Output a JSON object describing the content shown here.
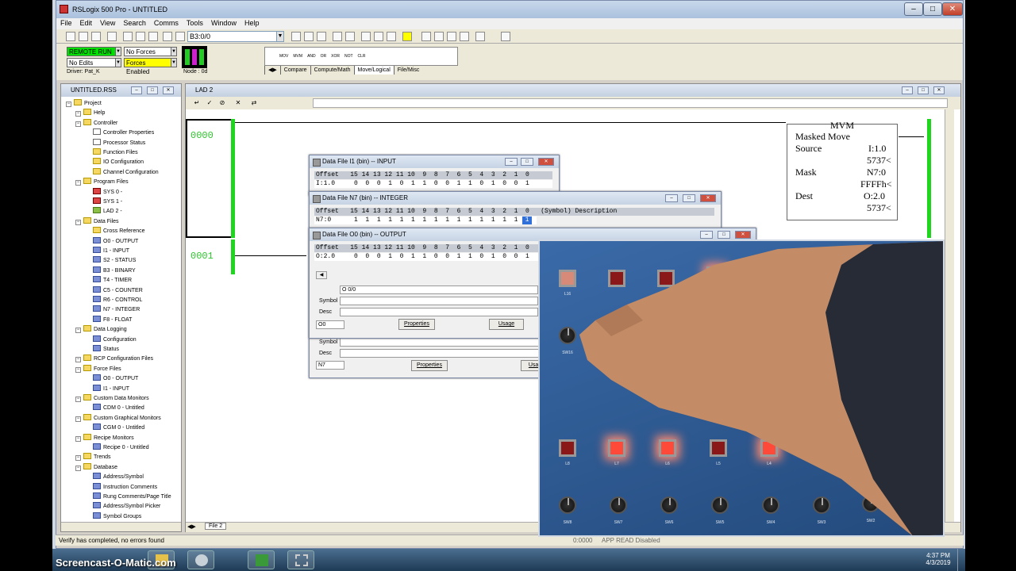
{
  "window": {
    "title": "RSLogix 500 Pro - UNTITLED"
  },
  "menu": [
    "File",
    "Edit",
    "View",
    "Search",
    "Comms",
    "Tools",
    "Window",
    "Help"
  ],
  "toolbar": {
    "address_value": "B3:0/0"
  },
  "processor": {
    "mode": "REMOTE RUN",
    "forces": "No Forces",
    "edits": "No Edits",
    "forces_enabled": "Forces Enabled",
    "node": "Node :  0d",
    "driver": "Driver: Pat_K"
  },
  "instruction_palette": {
    "items": [
      "MOV",
      "MVM",
      "AND",
      "OR",
      "XOR",
      "NOT",
      "CLR"
    ],
    "tabs": [
      "Compare",
      "Compute/Math",
      "Move/Logical",
      "File/Misc"
    ],
    "active_tab": "Move/Logical"
  },
  "project_window": {
    "title": "UNTITLED.RSS",
    "tree": [
      {
        "label": "Project",
        "level": 0,
        "icon": "folder-icon"
      },
      {
        "label": "Help",
        "level": 1,
        "icon": "folder-icon"
      },
      {
        "label": "Controller",
        "level": 1,
        "icon": "folder-icon"
      },
      {
        "label": "Controller Properties",
        "level": 2,
        "icon": "properties-icon"
      },
      {
        "label": "Processor Status",
        "level": 2,
        "icon": "status-icon"
      },
      {
        "label": "Function Files",
        "level": 2,
        "icon": "function-files-icon"
      },
      {
        "label": "IO Configuration",
        "level": 2,
        "icon": "io-config-icon"
      },
      {
        "label": "Channel Configuration",
        "level": 2,
        "icon": "channel-config-icon"
      },
      {
        "label": "Program Files",
        "level": 1,
        "icon": "folder-icon"
      },
      {
        "label": "SYS 0 -",
        "level": 2,
        "icon": "sys-file-icon"
      },
      {
        "label": "SYS 1 -",
        "level": 2,
        "icon": "sys-file-icon"
      },
      {
        "label": "LAD 2 -",
        "level": 2,
        "icon": "ladder-file-icon"
      },
      {
        "label": "Data Files",
        "level": 1,
        "icon": "folder-icon"
      },
      {
        "label": "Cross Reference",
        "level": 2,
        "icon": "cross-reference-icon"
      },
      {
        "label": "O0 - OUTPUT",
        "level": 2,
        "icon": "data-file-icon"
      },
      {
        "label": "I1 - INPUT",
        "level": 2,
        "icon": "data-file-icon"
      },
      {
        "label": "S2 - STATUS",
        "level": 2,
        "icon": "data-file-icon"
      },
      {
        "label": "B3 - BINARY",
        "level": 2,
        "icon": "data-file-icon"
      },
      {
        "label": "T4 - TIMER",
        "level": 2,
        "icon": "data-file-icon"
      },
      {
        "label": "C5 - COUNTER",
        "level": 2,
        "icon": "data-file-icon"
      },
      {
        "label": "R6 - CONTROL",
        "level": 2,
        "icon": "data-file-icon"
      },
      {
        "label": "N7 - INTEGER",
        "level": 2,
        "icon": "data-file-icon"
      },
      {
        "label": "F8 - FLOAT",
        "level": 2,
        "icon": "data-file-icon"
      },
      {
        "label": "Data Logging",
        "level": 1,
        "icon": "folder-icon"
      },
      {
        "label": "Configuration",
        "level": 2,
        "icon": "data-file-icon"
      },
      {
        "label": "Status",
        "level": 2,
        "icon": "data-file-icon"
      },
      {
        "label": "RCP Configuration Files",
        "level": 1,
        "icon": "folder-icon"
      },
      {
        "label": "Force Files",
        "level": 1,
        "icon": "folder-icon"
      },
      {
        "label": "O0 - OUTPUT",
        "level": 2,
        "icon": "data-file-icon"
      },
      {
        "label": "I1 - INPUT",
        "level": 2,
        "icon": "data-file-icon"
      },
      {
        "label": "Custom Data Monitors",
        "level": 1,
        "icon": "folder-icon"
      },
      {
        "label": "CDM 0 - Untitled",
        "level": 2,
        "icon": "data-file-icon"
      },
      {
        "label": "Custom Graphical Monitors",
        "level": 1,
        "icon": "folder-icon"
      },
      {
        "label": "CGM 0 - Untitled",
        "level": 2,
        "icon": "data-file-icon"
      },
      {
        "label": "Recipe Monitors",
        "level": 1,
        "icon": "folder-icon"
      },
      {
        "label": "Recipe 0 - Untitled",
        "level": 2,
        "icon": "data-file-icon"
      },
      {
        "label": "Trends",
        "level": 1,
        "icon": "folder-icon"
      },
      {
        "label": "Database",
        "level": 1,
        "icon": "folder-icon"
      },
      {
        "label": "Address/Symbol",
        "level": 2,
        "icon": "data-file-icon"
      },
      {
        "label": "Instruction Comments",
        "level": 2,
        "icon": "data-file-icon"
      },
      {
        "label": "Rung Comments/Page Title",
        "level": 2,
        "icon": "data-file-icon"
      },
      {
        "label": "Address/Symbol Picker",
        "level": 2,
        "icon": "data-file-icon"
      },
      {
        "label": "Symbol Groups",
        "level": 2,
        "icon": "data-file-icon"
      }
    ]
  },
  "ladder_window": {
    "title": "LAD 2",
    "rungs": [
      "0000",
      "0001"
    ],
    "file_tab": "File 2",
    "mvm": {
      "mnemonic": "MVM",
      "name": "Masked Move",
      "source_label": "Source",
      "source_addr": "I:1.0",
      "source_val": "5737<",
      "mask_label": "Mask",
      "mask_addr": "N7:0",
      "mask_val": "FFFFh<",
      "dest_label": "Dest",
      "dest_addr": "O:2.0",
      "dest_val": "5737<"
    }
  },
  "data_files": {
    "input": {
      "title": "Data File I1 (bin)  --  INPUT",
      "header": "Offset   15 14 13 12 11 10  9  8  7  6  5  4  3  2  1  0",
      "row": "I:1.0     0  0  0  1  0  1  1  0  0  1  1  0  1  0  0  1"
    },
    "integer": {
      "title": "Data File N7 (bin)  --  INTEGER",
      "header": "Offset   15 14 13 12 11 10  9  8  7  6  5  4  3  2  1  0   (Symbol) Description",
      "row": "N7:0      1  1  1  1  1  1  1  1  1  1  1  1  1  1  1",
      "selected_bit": "1",
      "symbol_label": "Symbol",
      "desc_label": "Desc",
      "radix": "N7",
      "properties": "Properties",
      "usage": "Usage"
    },
    "output": {
      "title": "Data File O0 (bin)  --  OUTPUT",
      "header": "Offset   15 14 13 12 11 10  9  8  7  6  5  4  3  2  1  0",
      "row": "O:2.0     0  0  0  1  0  1  1  0  0  1  1  0  1  0  0  1",
      "address": "O 0/0",
      "symbol_label": "Symbol",
      "desc_label": "Desc",
      "radix": "O0",
      "properties": "Properties",
      "usage": "Usage"
    }
  },
  "trainer_panel": {
    "top_label": "L16",
    "knob_label_top": "SW16",
    "lamp_labels": [
      "L8",
      "L7",
      "L6",
      "L5",
      "L4",
      "L3"
    ],
    "switch_labels": [
      "SW8",
      "SW7",
      "SW6",
      "SW5",
      "SW4",
      "SW3",
      "SW2"
    ]
  },
  "status_bar": {
    "message": "Verify has completed, no errors found",
    "address": "0:0000",
    "mode": "APP READ Disabled"
  },
  "taskbar": {
    "time": "4:37 PM",
    "date": "4/3/2019",
    "watermark": "Screencast-O-Matic.com"
  },
  "colors": {
    "rung_green": "#1fd61f",
    "remote_run_bg": "#00e000",
    "forces_enabled_bg": "#ffff00",
    "selected_bit_bg": "#3070d8"
  }
}
